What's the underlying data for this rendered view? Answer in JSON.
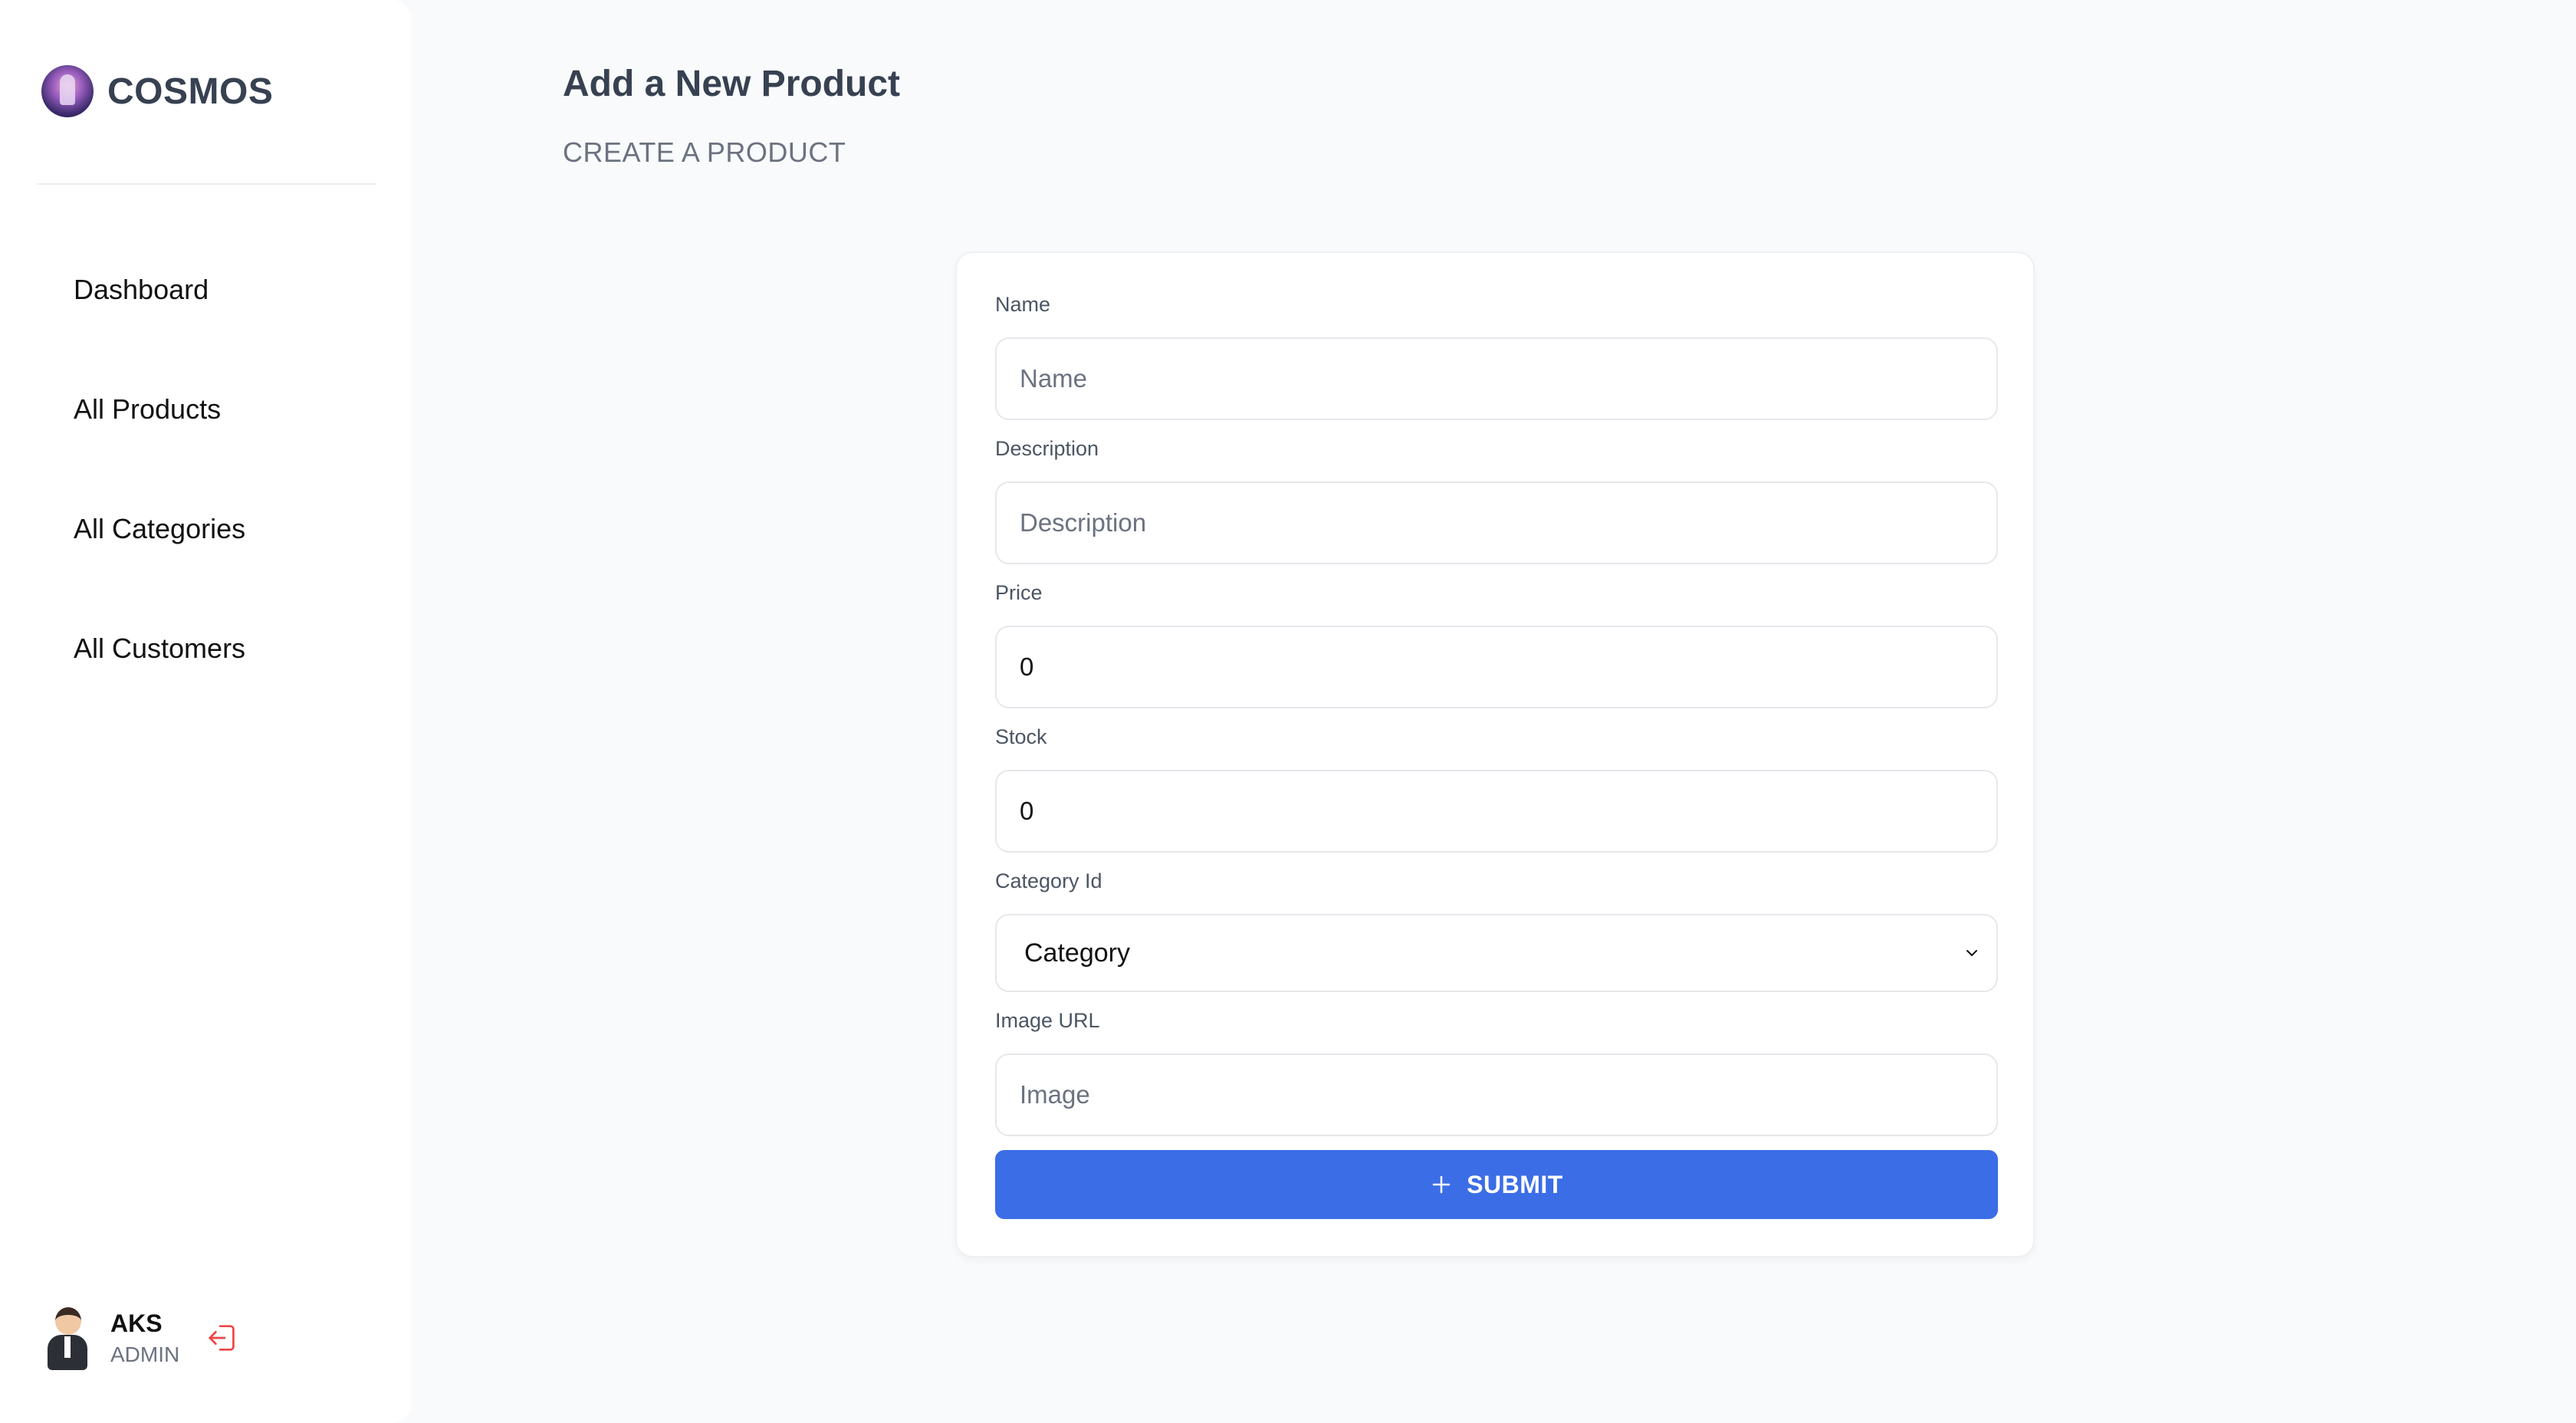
{
  "brand": {
    "name": "COSMOS"
  },
  "sidebar": {
    "items": [
      {
        "label": "Dashboard"
      },
      {
        "label": "All Products"
      },
      {
        "label": "All Categories"
      },
      {
        "label": "All Customers"
      }
    ]
  },
  "user": {
    "name": "AKS",
    "role": "ADMIN"
  },
  "header": {
    "title": "Add a New Product",
    "subtitle": "CREATE A PRODUCT"
  },
  "form": {
    "name": {
      "label": "Name",
      "placeholder": "Name",
      "value": ""
    },
    "description": {
      "label": "Description",
      "placeholder": "Description",
      "value": ""
    },
    "price": {
      "label": "Price",
      "value": "0"
    },
    "stock": {
      "label": "Stock",
      "value": "0"
    },
    "category": {
      "label": "Category Id",
      "selected": "Category"
    },
    "image": {
      "label": "Image URL",
      "placeholder": "Image",
      "value": ""
    },
    "submit_label": "SUBMIT"
  },
  "colors": {
    "primary": "#3b6de6",
    "logout": "#ef4444",
    "background": "#f9fafb"
  },
  "icons": {
    "brand": "cosmos-logo-icon",
    "logout": "logout-icon",
    "submit": "plus-icon",
    "select": "chevron-down-icon"
  }
}
